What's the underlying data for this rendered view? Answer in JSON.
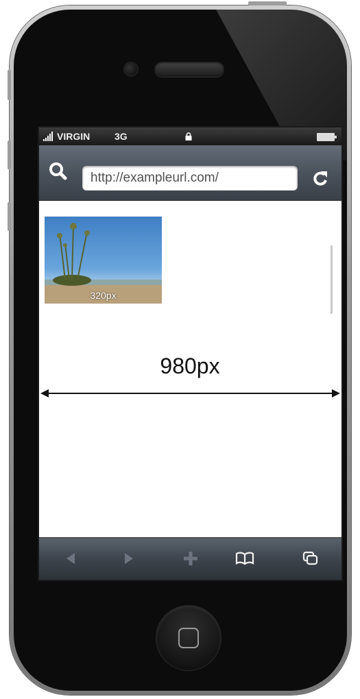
{
  "status_bar": {
    "carrier": "VIRGIN",
    "network": "3G",
    "signal_icon": "signal-bars-icon",
    "lock_icon": "lock-icon",
    "battery_icon": "battery-icon"
  },
  "nav_bar": {
    "url": "http://exampleurl.com/",
    "search_icon": "search-icon",
    "reload_icon": "reload-icon"
  },
  "content": {
    "thumbnail_label": "320px",
    "width_label": "980px"
  },
  "toolbar": {
    "items": [
      {
        "name": "back",
        "icon": "back-arrow-icon",
        "enabled": false
      },
      {
        "name": "forward",
        "icon": "forward-arrow-icon",
        "enabled": false
      },
      {
        "name": "add",
        "icon": "plus-icon",
        "enabled": false
      },
      {
        "name": "bookmarks",
        "icon": "book-icon",
        "enabled": true
      },
      {
        "name": "pages",
        "icon": "pages-icon",
        "enabled": true
      }
    ]
  },
  "colors": {
    "bar_dark": "#3a4048",
    "disabled_icon": "#6c7480",
    "enabled_icon": "#f2f2f2"
  }
}
